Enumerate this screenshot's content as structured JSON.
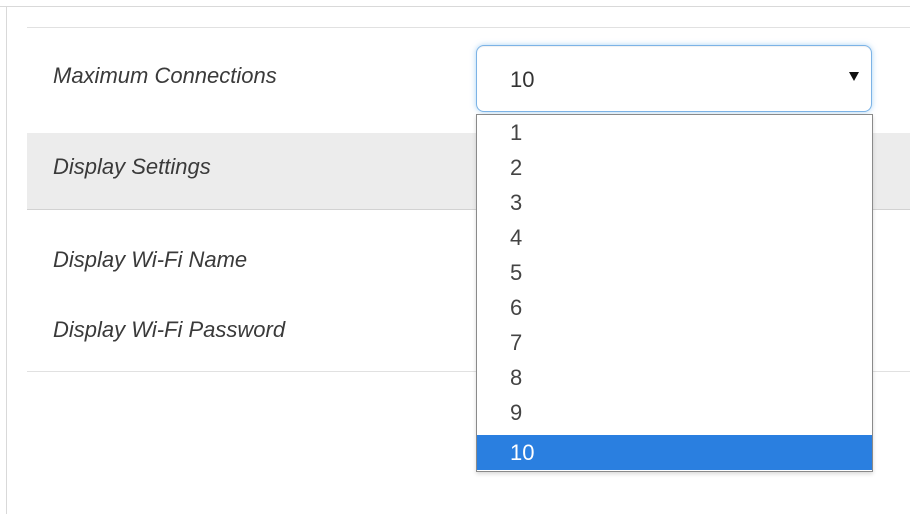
{
  "settings": {
    "max_connections_label": "Maximum Connections",
    "section_title": "Display Settings",
    "display_wifi_name_label": "Display Wi-Fi Name",
    "display_wifi_password_label": "Display Wi-Fi Password"
  },
  "max_connections_select": {
    "selected_value": "10",
    "options": [
      "1",
      "2",
      "3",
      "4",
      "5",
      "6",
      "7",
      "8",
      "9",
      "10"
    ],
    "highlighted_option": "10"
  },
  "colors": {
    "highlight": "#2a7fe0",
    "focus_border": "#7cb3e6",
    "section_band": "#ececec"
  },
  "icons": {
    "dropdown_arrow": "caret-down-icon"
  }
}
